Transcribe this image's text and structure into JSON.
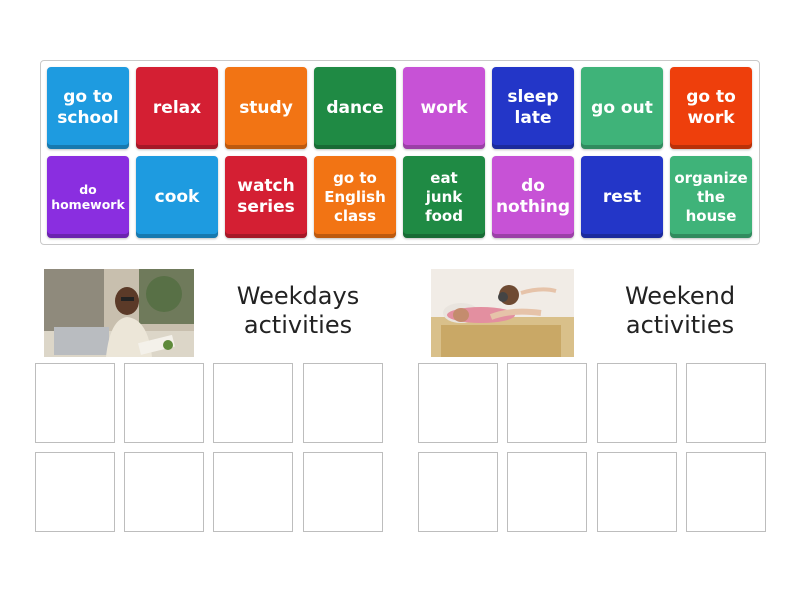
{
  "tiles": [
    {
      "label": "go to\nschool",
      "color": "#1e9be0"
    },
    {
      "label": "relax",
      "color": "#d41f33"
    },
    {
      "label": "study",
      "color": "#f27414"
    },
    {
      "label": "dance",
      "color": "#1f8a44"
    },
    {
      "label": "work",
      "color": "#c752d6"
    },
    {
      "label": "sleep\nlate",
      "color": "#2336c8"
    },
    {
      "label": "go out",
      "color": "#3fb379"
    },
    {
      "label": "go to\nwork",
      "color": "#ee3f0c"
    },
    {
      "label": "do\nhomework",
      "color": "#8a2ee0"
    },
    {
      "label": "cook",
      "color": "#1e9be0"
    },
    {
      "label": "watch\nseries",
      "color": "#d41f33"
    },
    {
      "label": "go to\nEnglish\nclass",
      "color": "#f27414"
    },
    {
      "label": "eat\njunk\nfood",
      "color": "#1f8a44"
    },
    {
      "label": "do\nnothing",
      "color": "#c752d6"
    },
    {
      "label": "rest",
      "color": "#2336c8"
    },
    {
      "label": "organize\nthe\nhouse",
      "color": "#3fb379"
    }
  ],
  "groups": {
    "weekdays": {
      "title": "Weekdays\nactivities"
    },
    "weekend": {
      "title": "Weekend\nactivities"
    }
  }
}
